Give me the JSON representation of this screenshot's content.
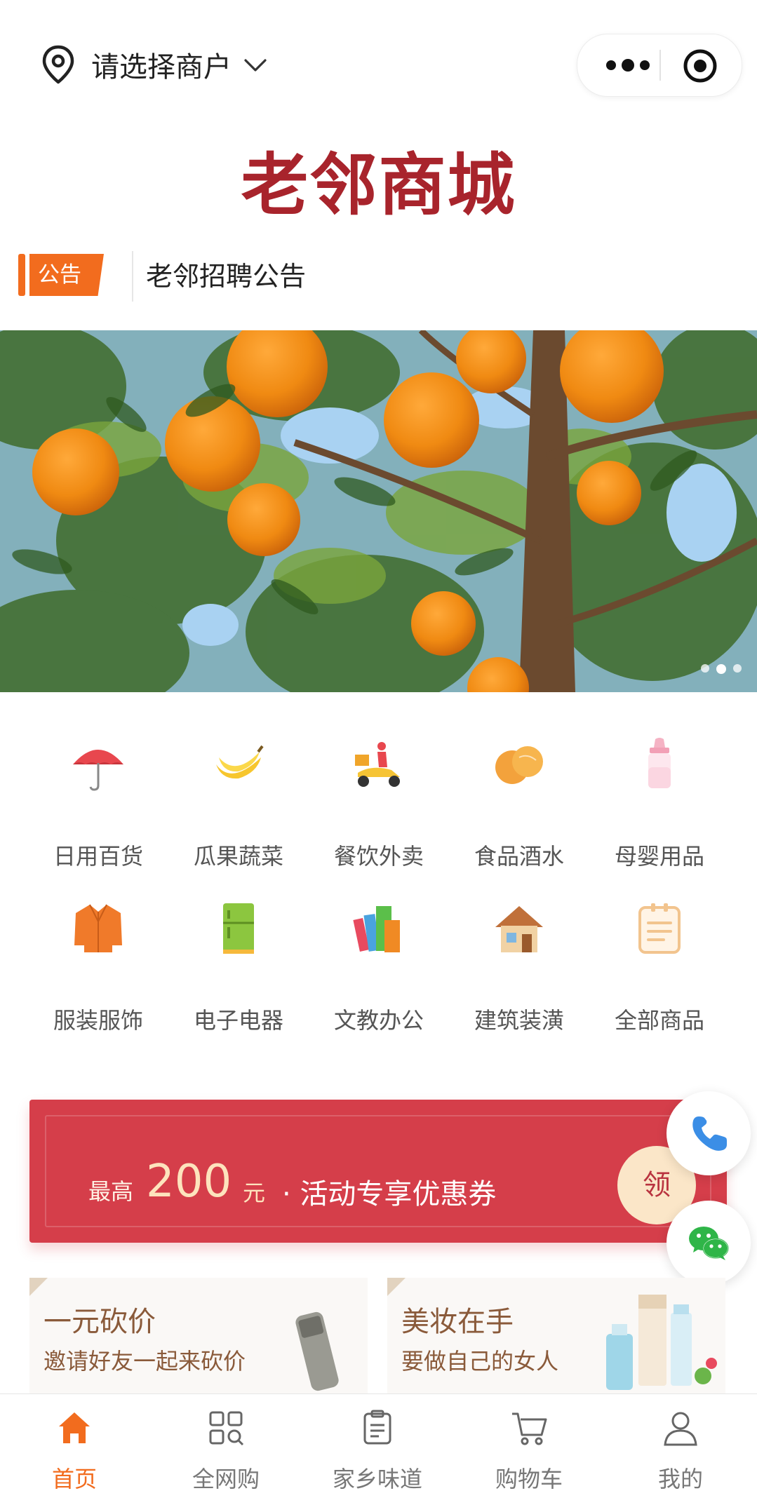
{
  "header": {
    "merchant_select": "请选择商户"
  },
  "logo": {
    "text": "老邻商城"
  },
  "notice": {
    "tag": "公告",
    "text": "老邻招聘公告"
  },
  "banner": {
    "slide_count": 3,
    "active_index": 1
  },
  "categories": [
    {
      "label": "日用百货",
      "icon": "umbrella-icon"
    },
    {
      "label": "瓜果蔬菜",
      "icon": "banana-icon"
    },
    {
      "label": "餐饮外卖",
      "icon": "delivery-scooter-icon"
    },
    {
      "label": "食品酒水",
      "icon": "oranges-icon"
    },
    {
      "label": "母婴用品",
      "icon": "baby-bottle-icon"
    },
    {
      "label": "服装服饰",
      "icon": "jacket-icon"
    },
    {
      "label": "电子电器",
      "icon": "refrigerator-icon"
    },
    {
      "label": "文教办公",
      "icon": "books-icon"
    },
    {
      "label": "建筑装潢",
      "icon": "house-icon"
    },
    {
      "label": "全部商品",
      "icon": "clipboard-icon"
    }
  ],
  "coupon": {
    "prefix": "最高",
    "amount": "200",
    "unit": "元",
    "separator": "·",
    "desc": "活动专享优惠券",
    "button": "领",
    "colors": {
      "bg": "#d53e4a",
      "text": "#fde3bd"
    }
  },
  "floating": {
    "phone_icon": "phone-icon",
    "wechat_icon": "wechat-icon"
  },
  "promos": [
    {
      "title": "一元砍价",
      "subtitle": "邀请好友一起来砍价"
    },
    {
      "title": "美妆在手",
      "subtitle": "要做自己的女人"
    }
  ],
  "tabbar": [
    {
      "label": "首页",
      "icon": "home-icon",
      "active": true
    },
    {
      "label": "全网购",
      "icon": "apps-grid-icon",
      "active": false
    },
    {
      "label": "家乡味道",
      "icon": "clipboard-list-icon",
      "active": false
    },
    {
      "label": "购物车",
      "icon": "cart-icon",
      "active": false
    },
    {
      "label": "我的",
      "icon": "user-icon",
      "active": false
    }
  ],
  "theme": {
    "accent": "#f26c1e",
    "brand": "#a8242c"
  }
}
